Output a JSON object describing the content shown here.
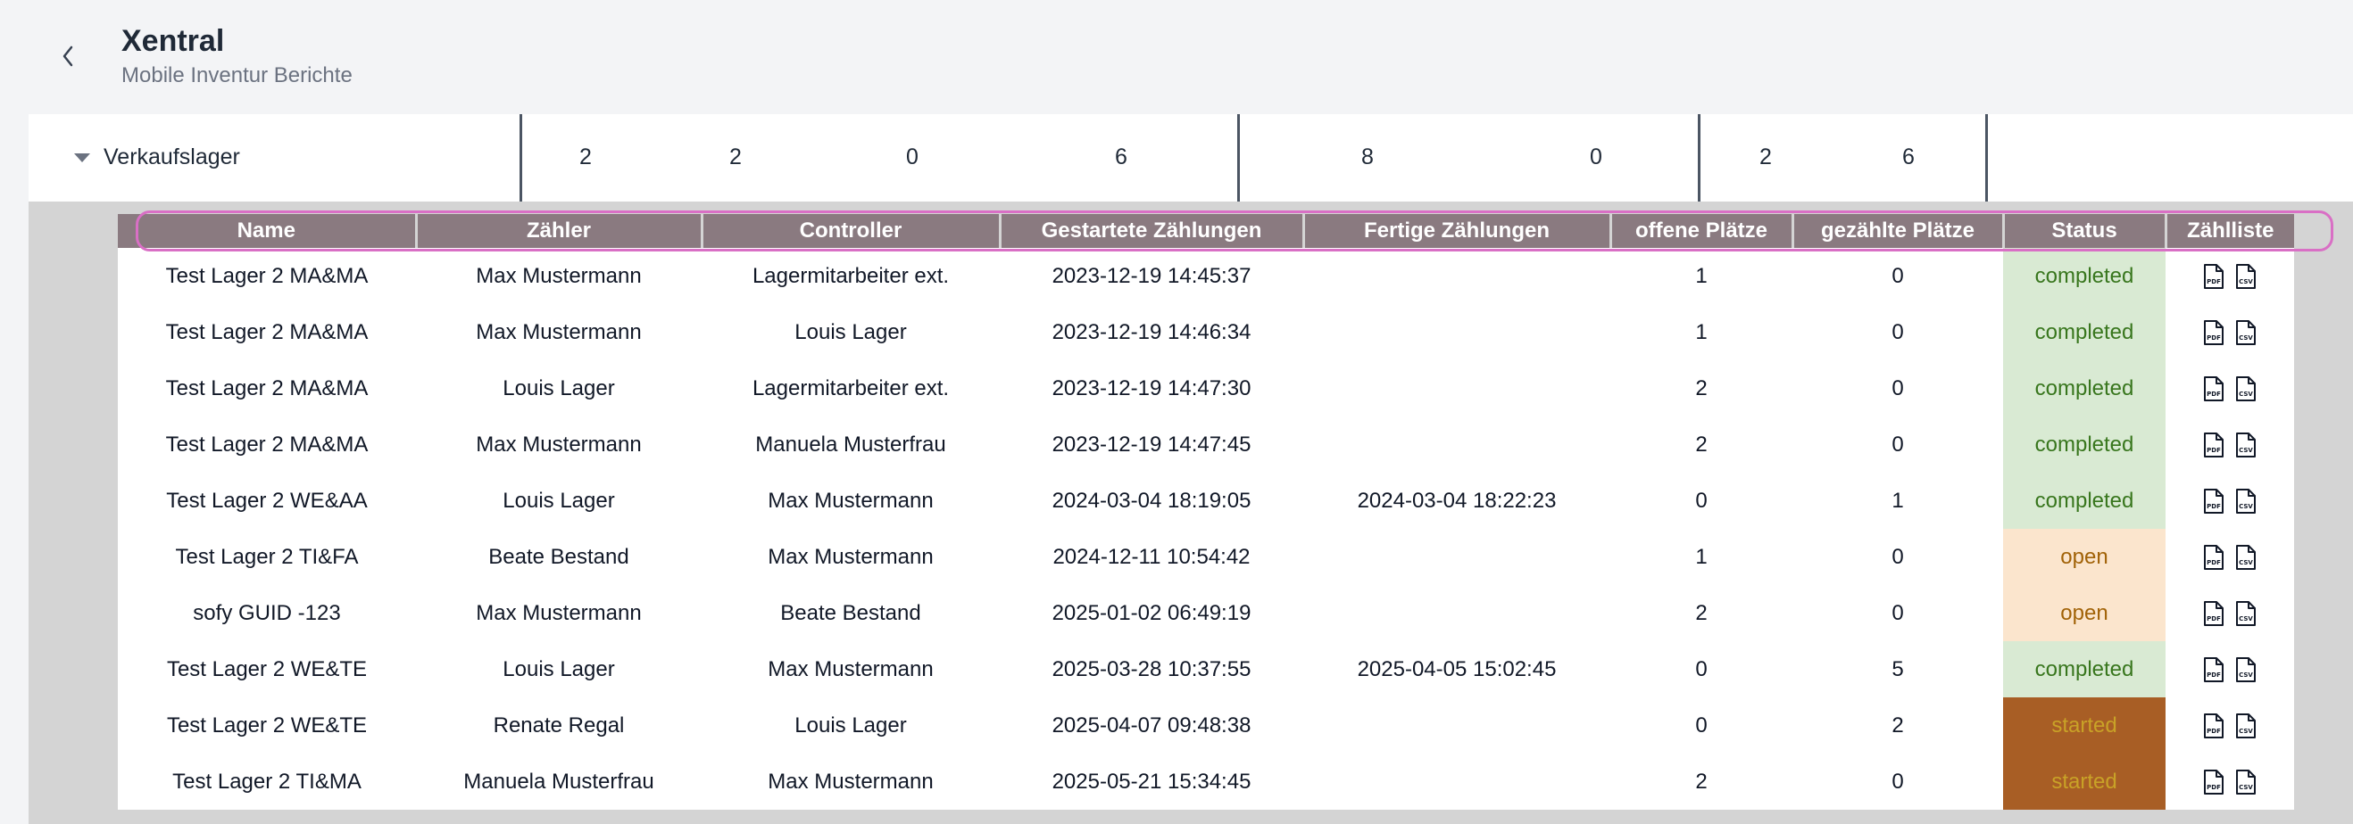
{
  "header": {
    "title": "Xentral",
    "subtitle": "Mobile Inventur Berichte"
  },
  "summary": {
    "label": "Verkaufslager",
    "values": [
      "2",
      "2",
      "0",
      "6",
      "8",
      "0",
      "2",
      "6"
    ]
  },
  "table": {
    "columns": [
      "Name",
      "Zähler",
      "Controller",
      "Gestartete Zählungen",
      "Fertige Zählungen",
      "offene Plätze",
      "gezählte Plätze",
      "Status",
      "Zählliste"
    ],
    "rows": [
      {
        "name": "Test Lager 2 MA&MA",
        "counter": "Max Mustermann",
        "controller": "Lagermitarbeiter ext.",
        "started": "2023-12-19 14:45:37",
        "finished": "",
        "open": "1",
        "counted": "0",
        "status": "completed"
      },
      {
        "name": "Test Lager 2 MA&MA",
        "counter": "Max Mustermann",
        "controller": "Louis Lager",
        "started": "2023-12-19 14:46:34",
        "finished": "",
        "open": "1",
        "counted": "0",
        "status": "completed"
      },
      {
        "name": "Test Lager 2 MA&MA",
        "counter": "Louis Lager",
        "controller": "Lagermitarbeiter ext.",
        "started": "2023-12-19 14:47:30",
        "finished": "",
        "open": "2",
        "counted": "0",
        "status": "completed"
      },
      {
        "name": "Test Lager 2 MA&MA",
        "counter": "Max Mustermann",
        "controller": "Manuela Musterfrau",
        "started": "2023-12-19 14:47:45",
        "finished": "",
        "open": "2",
        "counted": "0",
        "status": "completed"
      },
      {
        "name": "Test Lager 2 WE&AA",
        "counter": "Louis Lager",
        "controller": "Max Mustermann",
        "started": "2024-03-04 18:19:05",
        "finished": "2024-03-04 18:22:23",
        "open": "0",
        "counted": "1",
        "status": "completed"
      },
      {
        "name": "Test Lager 2 TI&FA",
        "counter": "Beate Bestand",
        "controller": "Max Mustermann",
        "started": "2024-12-11 10:54:42",
        "finished": "",
        "open": "1",
        "counted": "0",
        "status": "open"
      },
      {
        "name": "sofy GUID -123",
        "counter": "Max Mustermann",
        "controller": "Beate Bestand",
        "started": "2025-01-02 06:49:19",
        "finished": "",
        "open": "2",
        "counted": "0",
        "status": "open"
      },
      {
        "name": "Test Lager 2 WE&TE",
        "counter": "Louis Lager",
        "controller": "Max Mustermann",
        "started": "2025-03-28 10:37:55",
        "finished": "2025-04-05 15:02:45",
        "open": "0",
        "counted": "5",
        "status": "completed"
      },
      {
        "name": "Test Lager 2 WE&TE",
        "counter": "Renate Regal",
        "controller": "Louis Lager",
        "started": "2025-04-07 09:48:38",
        "finished": "",
        "open": "0",
        "counted": "2",
        "status": "started"
      },
      {
        "name": "Test Lager 2 TI&MA",
        "counter": "Manuela Musterfrau",
        "controller": "Max Mustermann",
        "started": "2025-05-21 15:34:45",
        "finished": "",
        "open": "2",
        "counted": "0",
        "status": "started"
      }
    ]
  },
  "icons": {
    "back": "chevron-left-icon",
    "toggle": "caret-down-icon",
    "pdf": "pdf-file-icon",
    "csv": "csv-file-icon"
  },
  "colors": {
    "header_bg": "#8a7a80",
    "completed_bg": "#d9ead3",
    "open_bg": "#fbe5cd",
    "started_bg": "#a85e25",
    "highlight": "#d96fc5"
  }
}
